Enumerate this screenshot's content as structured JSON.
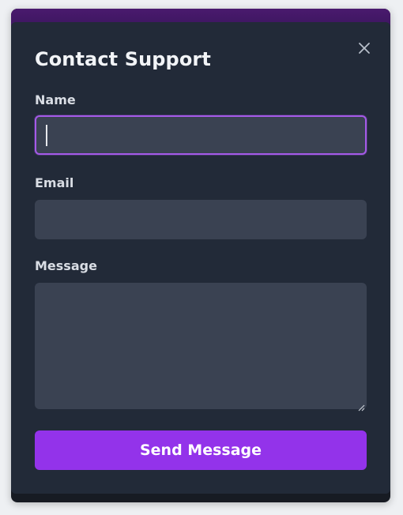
{
  "modal": {
    "title": "Contact Support",
    "close_icon": "close-icon"
  },
  "form": {
    "name_label": "Name",
    "name_value": "",
    "email_label": "Email",
    "email_value": "",
    "message_label": "Message",
    "message_value": "",
    "submit_label": "Send Message"
  },
  "colors": {
    "modal_bg": "#222a38",
    "input_bg": "#3a4252",
    "focus_ring": "#a55ae8",
    "accent": "#9333ea",
    "header_strip": "#4a1a6e"
  }
}
